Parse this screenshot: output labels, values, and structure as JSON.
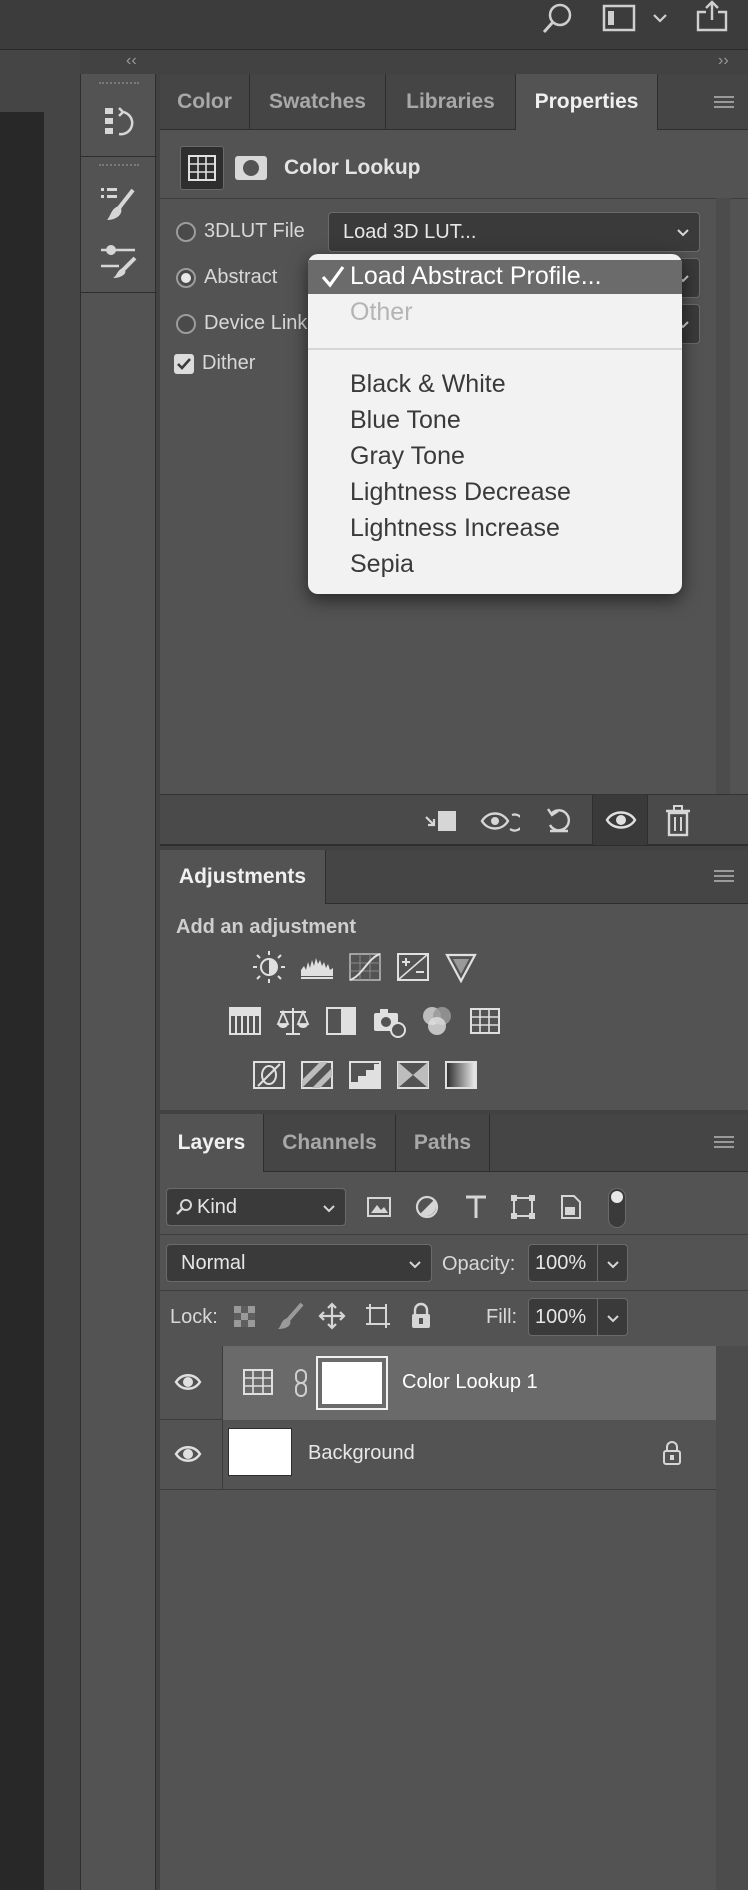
{
  "properties_tabs": [
    "Color",
    "Swatches",
    "Libraries",
    "Properties"
  ],
  "properties": {
    "title": "Color Lookup",
    "option_3dlut": "3DLUT File",
    "option_abstract": "Abstract",
    "option_device_link": "Device Link",
    "dither_label": "Dither",
    "lut_dropdown_value": "Load 3D LUT..."
  },
  "abstract_menu": {
    "selected": "Load Abstract Profile...",
    "disabled_item": "Other",
    "items": [
      "Black & White",
      "Blue Tone",
      "Gray Tone",
      "Lightness Decrease",
      "Lightness Increase",
      "Sepia"
    ]
  },
  "adjustments": {
    "tab_label": "Adjustments",
    "heading": "Add an adjustment"
  },
  "layers_tabs": [
    "Layers",
    "Channels",
    "Paths"
  ],
  "layers": {
    "filter_kind": "Kind",
    "blend_mode": "Normal",
    "opacity_label": "Opacity:",
    "opacity_value": "100%",
    "lock_label": "Lock:",
    "fill_label": "Fill:",
    "fill_value": "100%",
    "rows": [
      {
        "name": "Color Lookup 1"
      },
      {
        "name": "Background"
      }
    ]
  },
  "colors": {
    "panel_bg": "#535353",
    "app_bg": "#424242",
    "selected_layer": "#6a6a6a",
    "menu_highlight": "#6b6b6b"
  }
}
